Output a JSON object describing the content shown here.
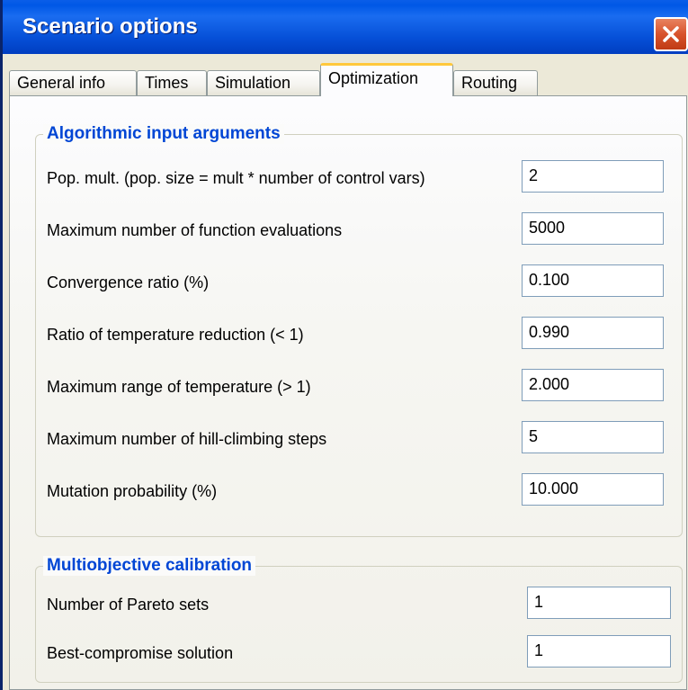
{
  "window": {
    "title": "Scenario options"
  },
  "tabs": [
    {
      "label": "General info",
      "active": false
    },
    {
      "label": "Times",
      "active": false
    },
    {
      "label": "Simulation",
      "active": false
    },
    {
      "label": "Optimization",
      "active": true
    },
    {
      "label": "Routing",
      "active": false
    }
  ],
  "algorithmic": {
    "title": "Algorithmic input arguments",
    "rows": [
      {
        "label": "Pop. mult. (pop. size = mult * number of control vars)",
        "value": "2"
      },
      {
        "label": "Maximum number of function evaluations",
        "value": "5000"
      },
      {
        "label": "Convergence ratio (%)",
        "value": "0.100"
      },
      {
        "label": "Ratio of temperature reduction (< 1)",
        "value": "0.990"
      },
      {
        "label": "Maximum range of temperature (> 1)",
        "value": "2.000"
      },
      {
        "label": "Maximum number of hill-climbing steps",
        "value": "5"
      },
      {
        "label": "Mutation probability (%)",
        "value": "10.000"
      }
    ]
  },
  "multiobjective": {
    "title": "Multiobjective calibration",
    "rows": [
      {
        "label": "Number of Pareto sets",
        "value": "1"
      },
      {
        "label": "Best-compromise solution",
        "value": "1"
      }
    ]
  },
  "colors": {
    "titlebar": "#0058e6",
    "group_title": "#0046d5",
    "close_button": "#d8532c",
    "active_tab_accent": "#ffc83c"
  },
  "icons": {
    "close": "close-icon"
  }
}
